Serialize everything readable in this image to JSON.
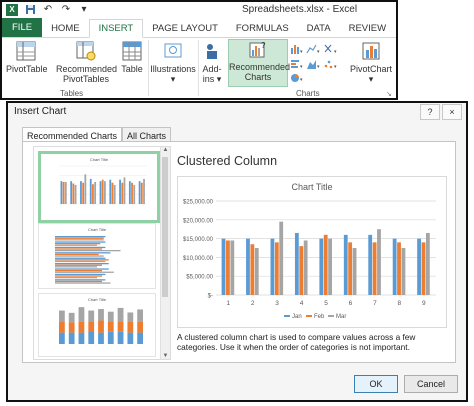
{
  "excel": {
    "window_title": "Spreadsheets.xlsx - Excel",
    "logo_text": "X",
    "quick_access_icons": [
      "save-icon",
      "undo-icon",
      "redo-icon"
    ],
    "tabs": [
      {
        "label": "FILE",
        "kind": "file"
      },
      {
        "label": "HOME",
        "kind": ""
      },
      {
        "label": "INSERT",
        "kind": "active"
      },
      {
        "label": "PAGE LAYOUT",
        "kind": ""
      },
      {
        "label": "FORMULAS",
        "kind": ""
      },
      {
        "label": "DATA",
        "kind": ""
      },
      {
        "label": "REVIEW",
        "kind": ""
      },
      {
        "label": "VIEW",
        "kind": ""
      }
    ],
    "ribbon": {
      "pivottable": "PivotTable",
      "recommended_pivottables_1": "Recommended",
      "recommended_pivottables_2": "PivotTables",
      "table": "Table",
      "tables_group": "Tables",
      "illustrations": "Illustrations",
      "addins_1": "Add-",
      "addins_2": "ins",
      "recommended_charts_1": "Recommended",
      "recommended_charts_2": "Charts",
      "pivotchart": "PivotChart",
      "charts_group": "Charts"
    },
    "brand_color": "#217346"
  },
  "dialog": {
    "title": "Insert Chart",
    "help_label": "?",
    "close_label": "×",
    "tabs": [
      "Recommended Charts",
      "All Charts"
    ],
    "thumbnail_title": "Chart Title",
    "heading": "Clustered Column",
    "description": "A clustered column chart is used to compare values across a few categories. Use it when the order of categories is not important.",
    "ok_label": "OK",
    "cancel_label": "Cancel",
    "selected_thumbnail": 1,
    "selection_color": "#8fd1a4"
  },
  "chart_data": {
    "type": "bar",
    "title": "Chart Title",
    "categories": [
      "1",
      "2",
      "3",
      "4",
      "5",
      "6",
      "7",
      "8",
      "9"
    ],
    "series": [
      {
        "name": "Jan",
        "color": "#5b9bd5",
        "values": [
          15000,
          15000,
          15000,
          16500,
          15000,
          16000,
          16000,
          15000,
          15000
        ]
      },
      {
        "name": "Feb",
        "color": "#ed7d31",
        "values": [
          14500,
          13500,
          14000,
          13000,
          16000,
          14000,
          14000,
          14000,
          14000
        ]
      },
      {
        "name": "Mar",
        "color": "#a5a5a5",
        "values": [
          14500,
          12500,
          19500,
          14500,
          15000,
          12500,
          17500,
          12500,
          16500
        ]
      }
    ],
    "ylim": [
      0,
      25000
    ],
    "yticks": [
      "$-",
      "$5,000.00",
      "$10,000.00",
      "$15,000.00",
      "$20,000.00",
      "$25,000.00"
    ],
    "grid": true,
    "legend": "bottom"
  }
}
